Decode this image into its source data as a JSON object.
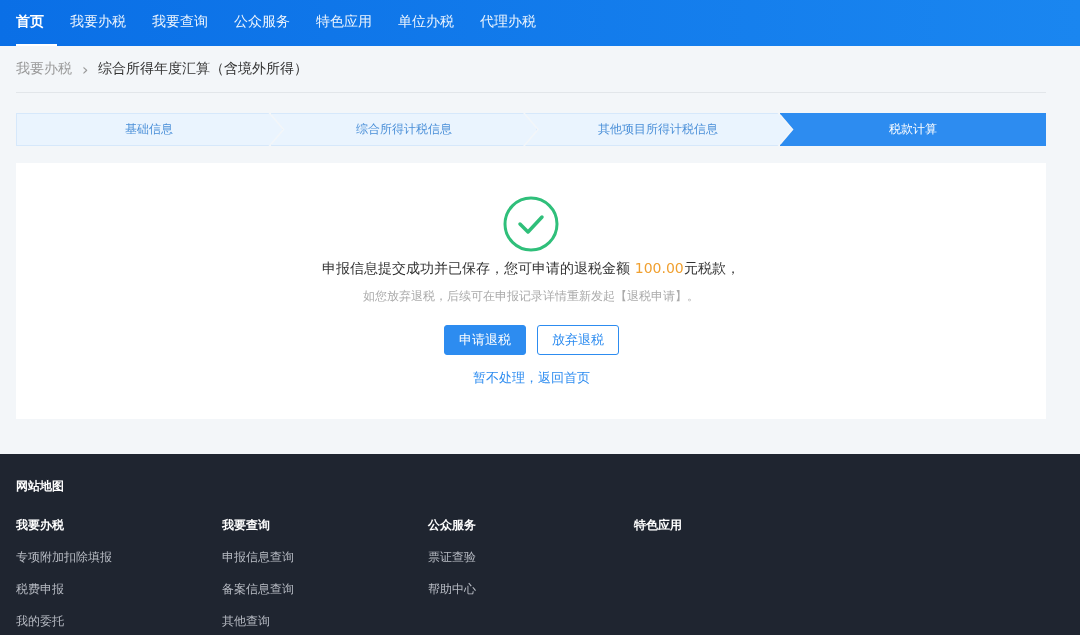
{
  "nav": {
    "items": [
      {
        "label": "首页",
        "selected": true
      },
      {
        "label": "我要办税",
        "selected": false
      },
      {
        "label": "我要查询",
        "selected": false
      },
      {
        "label": "公众服务",
        "selected": false
      },
      {
        "label": "特色应用",
        "selected": false
      },
      {
        "label": "单位办税",
        "selected": false
      },
      {
        "label": "代理办税",
        "selected": false
      }
    ]
  },
  "breadcrumb": {
    "parent": "我要办税",
    "separator": "›",
    "current": "综合所得年度汇算（含境外所得）"
  },
  "steps": [
    {
      "label": "基础信息",
      "selected": false
    },
    {
      "label": "综合所得计税信息",
      "selected": false
    },
    {
      "label": "其他项目所得计税信息",
      "selected": false
    },
    {
      "label": "税款计算",
      "selected": true
    }
  ],
  "result": {
    "message_before": "申报信息提交成功并已保存，您可申请的退税金额 ",
    "amount": "100.00",
    "message_after": "元税款，",
    "hint": "如您放弃退税，后续可在申报记录详情重新发起【退税申请】。",
    "buttons": [
      {
        "label": "申请退税",
        "kind": "primary"
      },
      {
        "label": "放弃退税",
        "kind": "outline"
      }
    ],
    "link": "暂不处理，返回首页"
  },
  "footer": {
    "title": "网站地图",
    "columns": [
      {
        "heading": "我要办税",
        "links": [
          "专项附加扣除填报",
          "税费申报",
          "我的委托"
        ]
      },
      {
        "heading": "我要查询",
        "links": [
          "申报信息查询",
          "备案信息查询",
          "其他查询"
        ]
      },
      {
        "heading": "公众服务",
        "links": [
          "票证查验",
          "帮助中心"
        ]
      },
      {
        "heading": "特色应用"
      }
    ]
  }
}
